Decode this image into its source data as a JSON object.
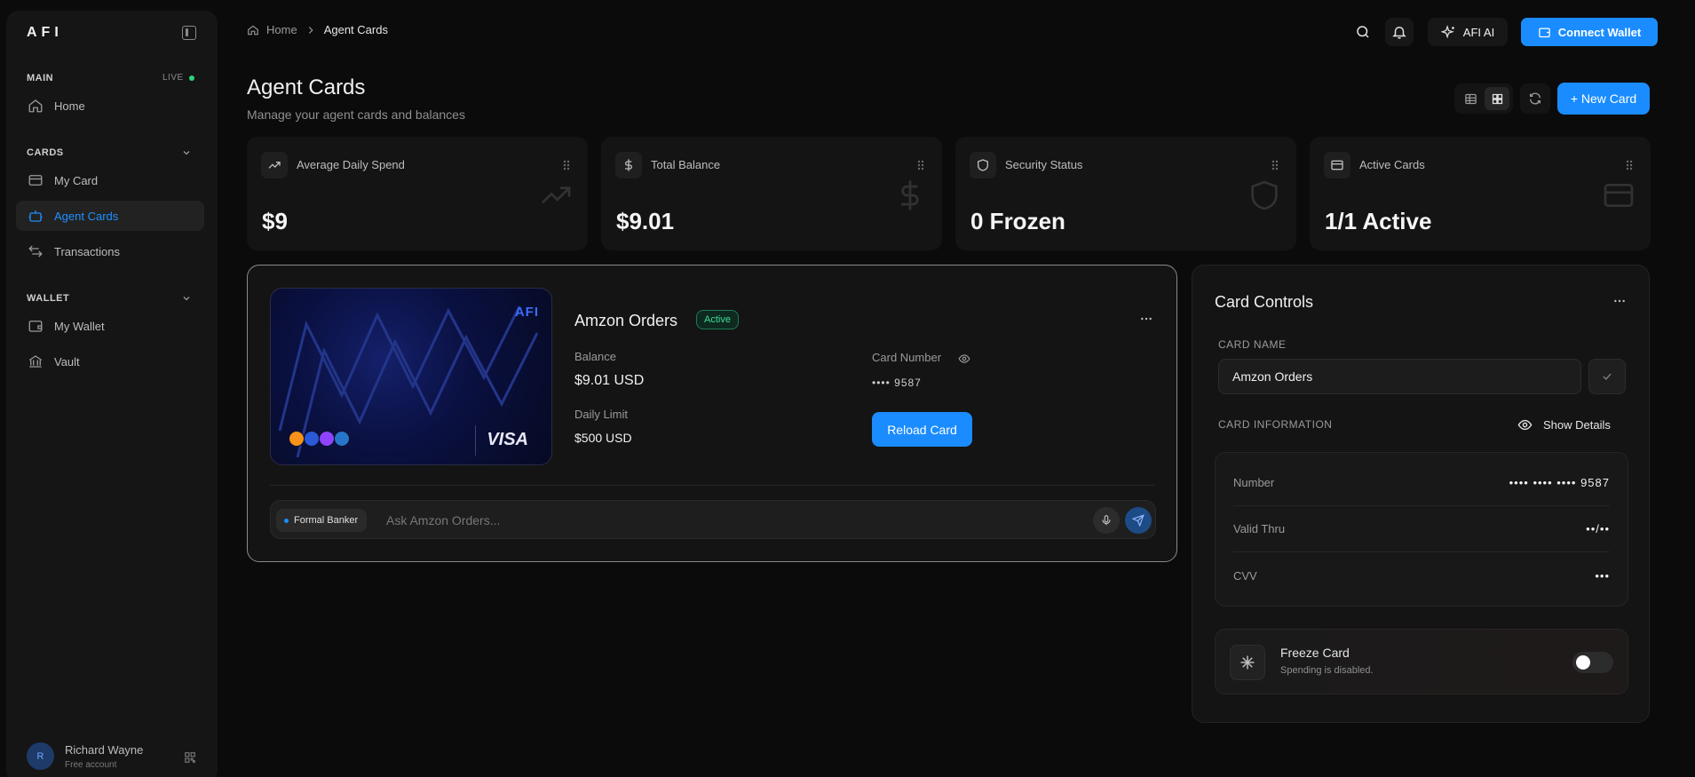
{
  "sidebar": {
    "logo": "AFI",
    "main_label": "MAIN",
    "live_label": "LIVE",
    "home": "Home",
    "cards_label": "CARDS",
    "my_card": "My Card",
    "agent_cards": "Agent Cards",
    "transactions": "Transactions",
    "wallet_label": "WALLET",
    "my_wallet": "My Wallet",
    "vault": "Vault",
    "user": {
      "initial": "R",
      "name": "Richard Wayne",
      "plan": "Free account"
    }
  },
  "header": {
    "breadcrumb_home": "Home",
    "breadcrumb_current": "Agent Cards",
    "ai_label": "AFI AI",
    "connect_label": "Connect Wallet"
  },
  "page": {
    "title": "Agent Cards",
    "subtitle": "Manage your agent cards and balances",
    "new_card": "+ New Card"
  },
  "stats": [
    {
      "label": "Average Daily Spend",
      "value": "$9"
    },
    {
      "label": "Total Balance",
      "value": "$9.01"
    },
    {
      "label": "Security Status",
      "value": "0 Frozen"
    },
    {
      "label": "Active Cards",
      "value": "1/1 Active"
    }
  ],
  "card": {
    "brand": "AFI",
    "network": "VISA",
    "name": "Amzon Orders",
    "status": "Active",
    "balance_label": "Balance",
    "balance": "$9.01 USD",
    "limit_label": "Daily Limit",
    "limit": "$500 USD",
    "number_label": "Card Number",
    "number_masked": "•••• 9587",
    "reload": "Reload Card",
    "persona": "Formal Banker",
    "ask_placeholder": "Ask Amzon Orders..."
  },
  "controls": {
    "title": "Card Controls",
    "name_label": "CARD NAME",
    "name_value": "Amzon Orders",
    "info_label": "CARD INFORMATION",
    "show_details": "Show Details",
    "rows": [
      {
        "label": "Number",
        "value": "•••• •••• •••• 9587"
      },
      {
        "label": "Valid Thru",
        "value": "••/••"
      },
      {
        "label": "CVV",
        "value": "•••"
      }
    ],
    "freeze_title": "Freeze Card",
    "freeze_sub": "Spending is disabled."
  },
  "colors": {
    "accent": "#1a8cff",
    "success": "#3ddc97",
    "live": "#2dd47a"
  }
}
